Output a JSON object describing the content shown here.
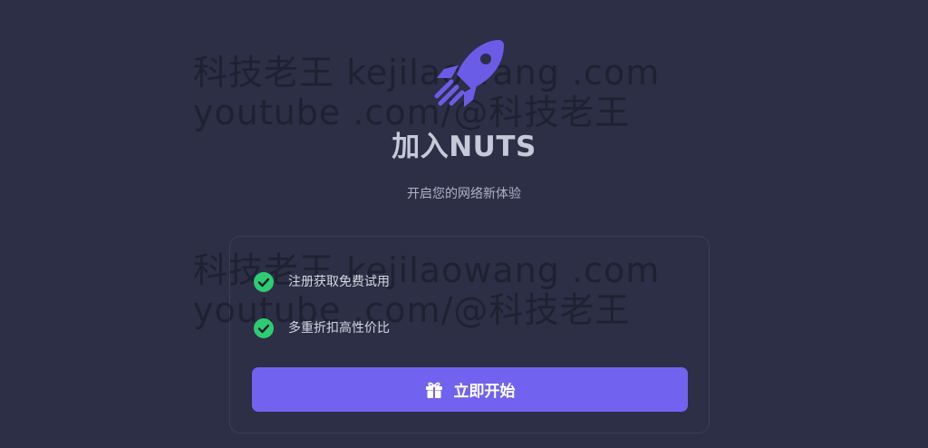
{
  "watermark": {
    "line1": "科技老王 kejilaowang .com",
    "line2": "youtube .com/@科技老王"
  },
  "header": {
    "logo_icon": "rocket-icon",
    "title": "加入NUTS",
    "subtitle": "开启您的网络新体验"
  },
  "features": [
    {
      "icon": "check-circle-icon",
      "label": "注册获取免费试用"
    },
    {
      "icon": "check-circle-icon",
      "label": "多重折扣高性价比"
    }
  ],
  "cta": {
    "icon": "gift-icon",
    "label": "立即开始"
  },
  "colors": {
    "background": "#2c2f45",
    "accent": "#7163ef",
    "check": "#2ecc71",
    "title": "#c7c8d8"
  }
}
